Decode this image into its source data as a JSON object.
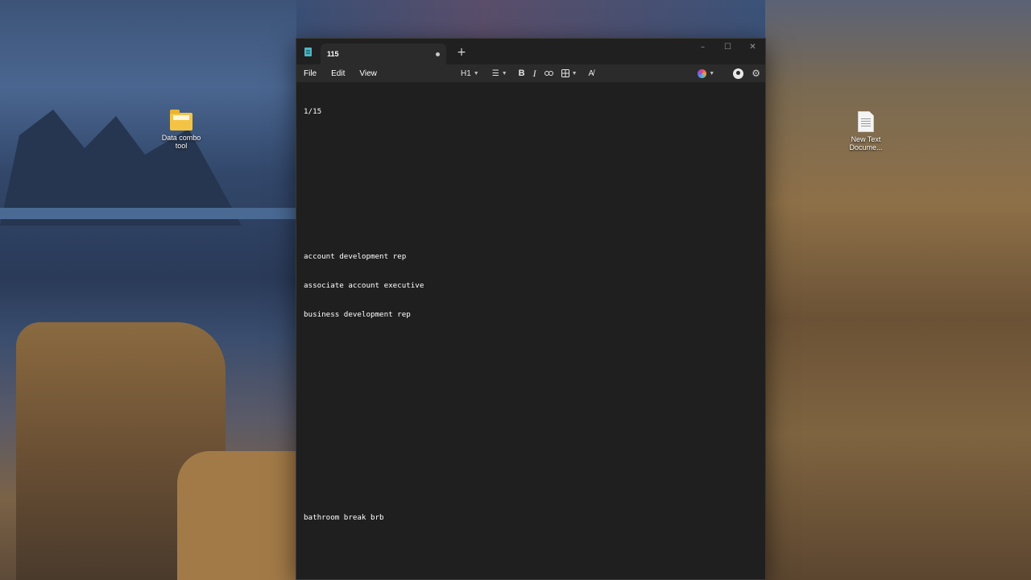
{
  "desktop": {
    "icons": [
      {
        "label": "Data combo tool",
        "icon": "folder-icon"
      },
      {
        "label": "New Text Docume...",
        "icon": "text-document-icon"
      }
    ]
  },
  "window": {
    "tab": {
      "title": "115",
      "unsaved_indicator": "•"
    },
    "new_tab": "+",
    "controls": {
      "minimize": "–",
      "maximize": "☐",
      "close": "✕"
    },
    "menu": [
      "File",
      "Edit",
      "View"
    ],
    "toolbar": {
      "heading": "H1",
      "list_icon": "list-icon",
      "bold": "B",
      "italic": "I",
      "link_icon": "link-icon",
      "table_icon": "table-icon",
      "clear_format_icon": "clear-formatting-icon",
      "copilot_icon": "copilot-icon",
      "account_icon": "account-icon",
      "settings_icon": "gear-icon"
    }
  },
  "document": {
    "lines": [
      "1/15",
      "",
      "",
      "",
      "",
      "account development rep",
      "associate account executive",
      "business development rep",
      "",
      "",
      "",
      "",
      "",
      "",
      "bathroom break brb"
    ]
  },
  "colors": {
    "window_bg": "#1f1f1f",
    "toolbar_bg": "#2b2b2b",
    "text": "#ffffff",
    "app_icon": "#4fb6c4",
    "folder": "#f3c444"
  }
}
